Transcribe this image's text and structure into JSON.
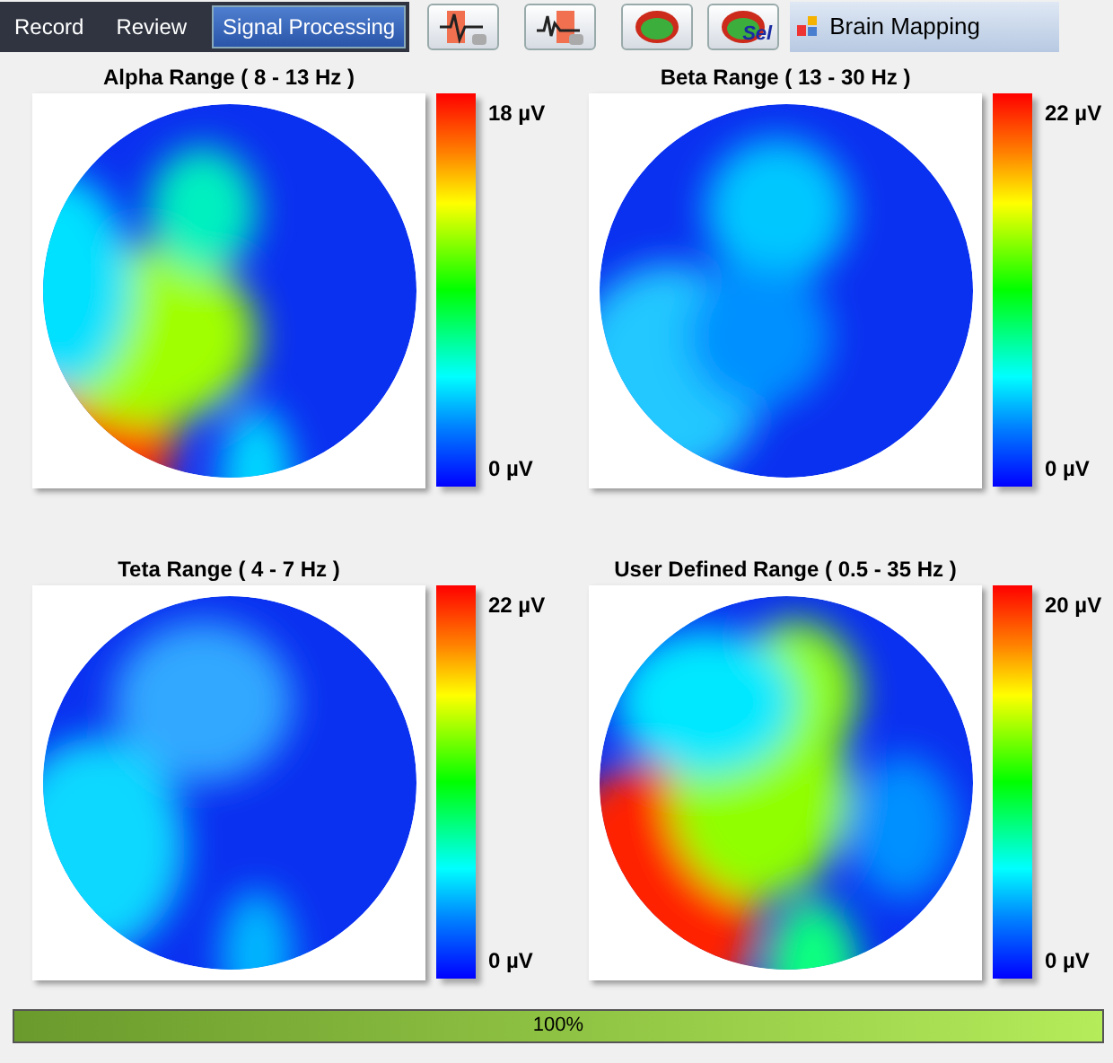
{
  "tabs": [
    {
      "label": "Record",
      "selected": false
    },
    {
      "label": "Review",
      "selected": false
    },
    {
      "label": "Signal Processing",
      "selected": true
    }
  ],
  "toolbar": {
    "panel_title": "Brain Mapping",
    "sel_label": "Sel"
  },
  "maps": [
    {
      "title": "Alpha Range ( 8 - 13 Hz )",
      "max_label": "18 µV",
      "min_label": "0 µV"
    },
    {
      "title": "Beta Range ( 13 - 30 Hz )",
      "max_label": "22 µV",
      "min_label": "0 µV"
    },
    {
      "title": "Teta Range ( 4 - 7 Hz )",
      "max_label": "22 µV",
      "min_label": "0 µV"
    },
    {
      "title": "User Defined Range ( 0.5 - 35 Hz )",
      "max_label": "20 µV",
      "min_label": "0 µV"
    }
  ],
  "progress": {
    "level": 1,
    "label": "100%"
  }
}
